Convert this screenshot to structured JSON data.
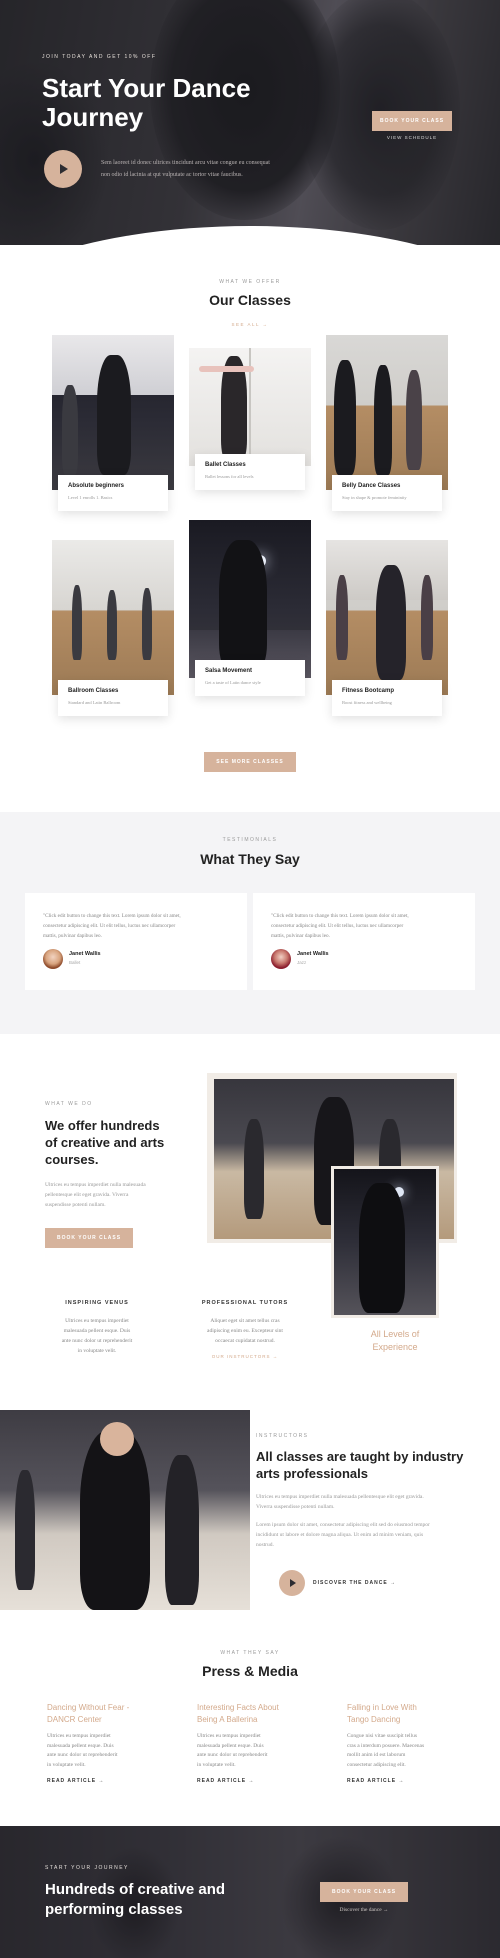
{
  "hero": {
    "eyebrow": "JOIN TODAY AND GET 10% OFF",
    "title_line1": "Start Your Dance",
    "title_line2": "Journey",
    "text_line1": "Sem laoreet id donec ultrices tincidunt arcu vitae congue eu consequat",
    "text_line2": "non odio id lacinia at qut vulputate ac tortor vitae faucibus.",
    "cta": "BOOK YOUR CLASS",
    "cta_sub": "VIEW SCHEDULE"
  },
  "classes": {
    "eyebrow": "WHAT WE OFFER",
    "title": "Our Classes",
    "see_all": "SEE ALL →",
    "items": [
      {
        "name": "Absolute beginners",
        "sub": "Level 1 enrolls 1. Basics"
      },
      {
        "name": "Ballet Classes",
        "sub": "Ballet lessons for all levels"
      },
      {
        "name": "Belly Dance Classes",
        "sub": "Stay in shape & promote femininity"
      },
      {
        "name": "Ballroom Classes",
        "sub": "Standard and Latin Ballroom"
      },
      {
        "name": "Salsa Movement",
        "sub": "Get a taste of Latin dance style"
      },
      {
        "name": "Fitness Bootcamp",
        "sub": "Boost fitness and wellbeing"
      }
    ],
    "more_button": "SEE MORE CLASSES"
  },
  "testimonials": {
    "eyebrow": "TESTIMONIALS",
    "title": "What They Say",
    "items": [
      {
        "line1": "\"Click edit button to change this text. Lorem ipsum dolor sit amet,",
        "line2": "consectetur adipiscing elit. Ut elit tellus, luctus nec ullamcorper",
        "line3": "mattis, pulvinar dapibus leo.",
        "name": "Janet Wallis",
        "role": "Ballet"
      },
      {
        "line1": "\"Click edit button to change this text. Lorem ipsum dolor sit amet,",
        "line2": "consectetur adipiscing elit. Ut elit tellus, luctus nec ullamcorper",
        "line3": "mattis, pulvinar dapibus leo.",
        "name": "Janet Wallis",
        "role": "Jazz"
      }
    ]
  },
  "about": {
    "eyebrow": "WHAT WE DO",
    "title_line1": "We offer hundreds",
    "title_line2": "of creative and arts",
    "title_line3": "courses.",
    "text_line1": "Ultrices eu tempus imperdiet nulla malesuada",
    "text_line2": "pellentesque elit eget gravida. Viverra",
    "text_line3": "suspendisse potenti nullam.",
    "button": "BOOK YOUR CLASS",
    "levels_line1": "All Levels of",
    "levels_line2": "Experience"
  },
  "features": [
    {
      "title": "INSPIRING VENUS",
      "line1": "Ultrices eu tempus imperdiet",
      "line2": "malesuada pellent esque. Duis",
      "line3": "ante nunc dolor ut reprehenderit",
      "line4": "in voluptate velit."
    },
    {
      "title": "PROFESSIONAL TUTORS",
      "line1": "Aliquet eget sit amet tellus cras",
      "line2": "adipiscing enim eu. Excepteur sint",
      "line3": "occaecat cupidatat nostrud.",
      "line4": "",
      "link": "OUR INSTRUCTORS →"
    }
  ],
  "instructors": {
    "eyebrow": "INSTRUCTORS",
    "title_line1": "All classes are taught by industry",
    "title_line2": "arts professionals",
    "p1_line1": "Ultrices eu tempus imperdiet nulla malesuada pellentesque elit eget gravida.",
    "p1_line2": "Viverra suspendisse potenti nullam.",
    "p2_line1": "Lorem ipsum dolor sit amet, consectetur adipiscing elit sed do eiusmod tempor",
    "p2_line2": "incididunt ut labore et dolore magna aliqua. Ut enim ad minim veniam, quis",
    "p2_line3": "nostrud.",
    "cta": "DISCOVER THE DANCE →"
  },
  "press": {
    "eyebrow": "WHAT THEY SAY",
    "title": "Press & Media",
    "items": [
      {
        "title_line1": "Dancing Without Fear -",
        "title_line2": "DANCR Center",
        "line1": "Ultrices eu tempus imperdiet",
        "line2": "malesuada pellent esque. Duis",
        "line3": "ante nunc dolor ut reprehenderit",
        "line4": "in voluptate velit.",
        "link": "READ ARTICLE →"
      },
      {
        "title_line1": "Interesting Facts About",
        "title_line2": "Being A Ballerina",
        "line1": "Ultrices eu tempus imperdiet",
        "line2": "malesuada pellent esque. Duis",
        "line3": "ante nunc dolor ut reprehenderit",
        "line4": "in voluptate velit.",
        "link": "READ ARTICLE →"
      },
      {
        "title_line1": "Falling in Love With",
        "title_line2": "Tango Dancing",
        "line1": "Congue nisi vitae suscipit tellus",
        "line2": "cras a interdum posuere. Maecenas",
        "line3": "mollit anim id est laborum",
        "line4": "consectetur adipiscing elit.",
        "link": "READ ARTICLE →"
      }
    ]
  },
  "footer_cta": {
    "eyebrow": "START YOUR JOURNEY",
    "title_line1": "Hundreds of creative and",
    "title_line2": "performing classes",
    "button": "BOOK YOUR CLASS",
    "link": "Discover the dance →"
  },
  "colors": {
    "accent": "#d6b39c",
    "accent_text": "#d3a98b",
    "light_bg": "#f4f4f6",
    "dark_bg": "#2d2c31"
  }
}
